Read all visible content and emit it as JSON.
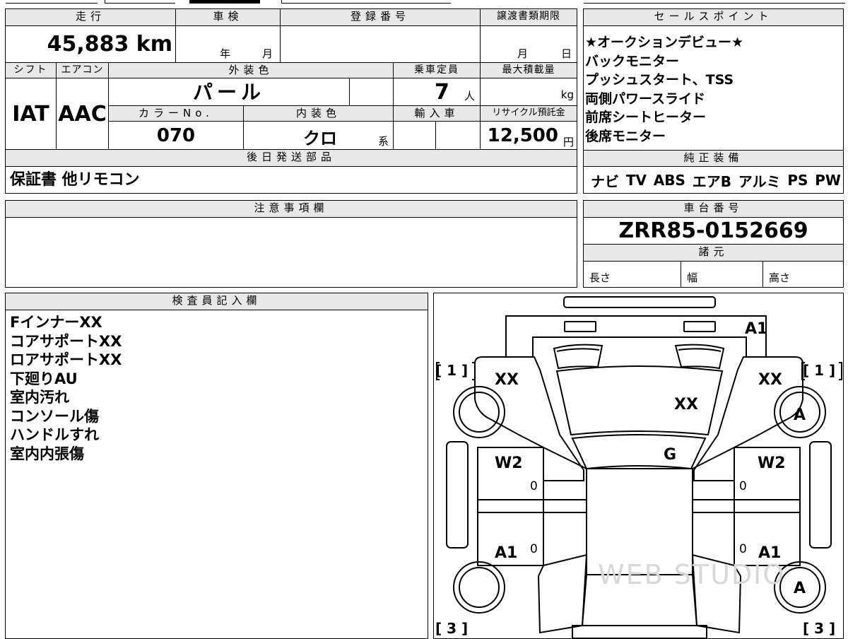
{
  "header": {
    "mileage_label": "走行",
    "shaken_label": "車検",
    "reg_label": "登録番号",
    "transfer_label": "譲渡書類期限",
    "mileage": "45,883 km",
    "year": "年",
    "month": "月",
    "t_month": "月",
    "t_day": "日"
  },
  "spec": {
    "shift_label": "シフト",
    "ac_label": "エアコン",
    "color_label": "外装色",
    "capacity_label": "乗車定員",
    "maxload_label": "最大積載量",
    "shift": "IAT",
    "ac": "AAC",
    "color": "パール",
    "capacity": "7",
    "capacity_unit": "人",
    "load_unit": "kg",
    "colorno_label": "カラーNo.",
    "interior_label": "内装色",
    "import_label": "輸入車",
    "recycle_label": "リサイクル預託金",
    "colorno": "070",
    "interior": "クロ",
    "interior_suffix": "系",
    "recycle": "12,500",
    "recycle_unit": "円"
  },
  "parts": {
    "label": "後日発送部品",
    "value": "保証書 他リモコン"
  },
  "sales": {
    "label": "セールスポイント",
    "items": [
      "★オークションデビュー★",
      "バックモニター",
      "プッシュスタート、TSS",
      "両側パワースライド",
      "前席シートヒーター",
      "後席モニター"
    ]
  },
  "equipment": {
    "label": "純正装備",
    "items": [
      "ナビ",
      "TV",
      "ABS",
      "エアB",
      "アルミ",
      "PS",
      "PW"
    ]
  },
  "caution": {
    "label": "注意事項欄"
  },
  "chassis": {
    "label": "車台番号",
    "value": "ZRR85-0152669",
    "spec_label": "諸元",
    "length": "長さ",
    "width": "幅",
    "height": "高さ"
  },
  "inspector": {
    "label": "検査員記入欄",
    "lines": [
      "FインナーXX",
      "コアサポートXX",
      "ロアサポートXX",
      "下廻りAU",
      "室内汚れ",
      "コンソール傷",
      "ハンドルすれ",
      "室内内張傷"
    ]
  },
  "diagram": {
    "marks": {
      "front_right": "A1",
      "front_left_fender": "XX",
      "front_right_fender": "XX",
      "hood": "XX",
      "windshield": "G",
      "left_front_door": "W2",
      "right_front_door": "W2",
      "left_rear_door": "A1",
      "right_rear_door": "A1",
      "right_front_wheel": "A",
      "right_rear_wheel": "A",
      "door_zero_1": "0",
      "door_zero_2": "0",
      "door_zero_3": "0",
      "door_zero_4": "0"
    },
    "tire_left_front": "[ 1 ]",
    "tire_right_front": "[ 1 ]",
    "tire_left_rear": "[ 3 ]",
    "tire_right_rear": "[ 3 ]",
    "watermark": "WEB STUDIO"
  }
}
